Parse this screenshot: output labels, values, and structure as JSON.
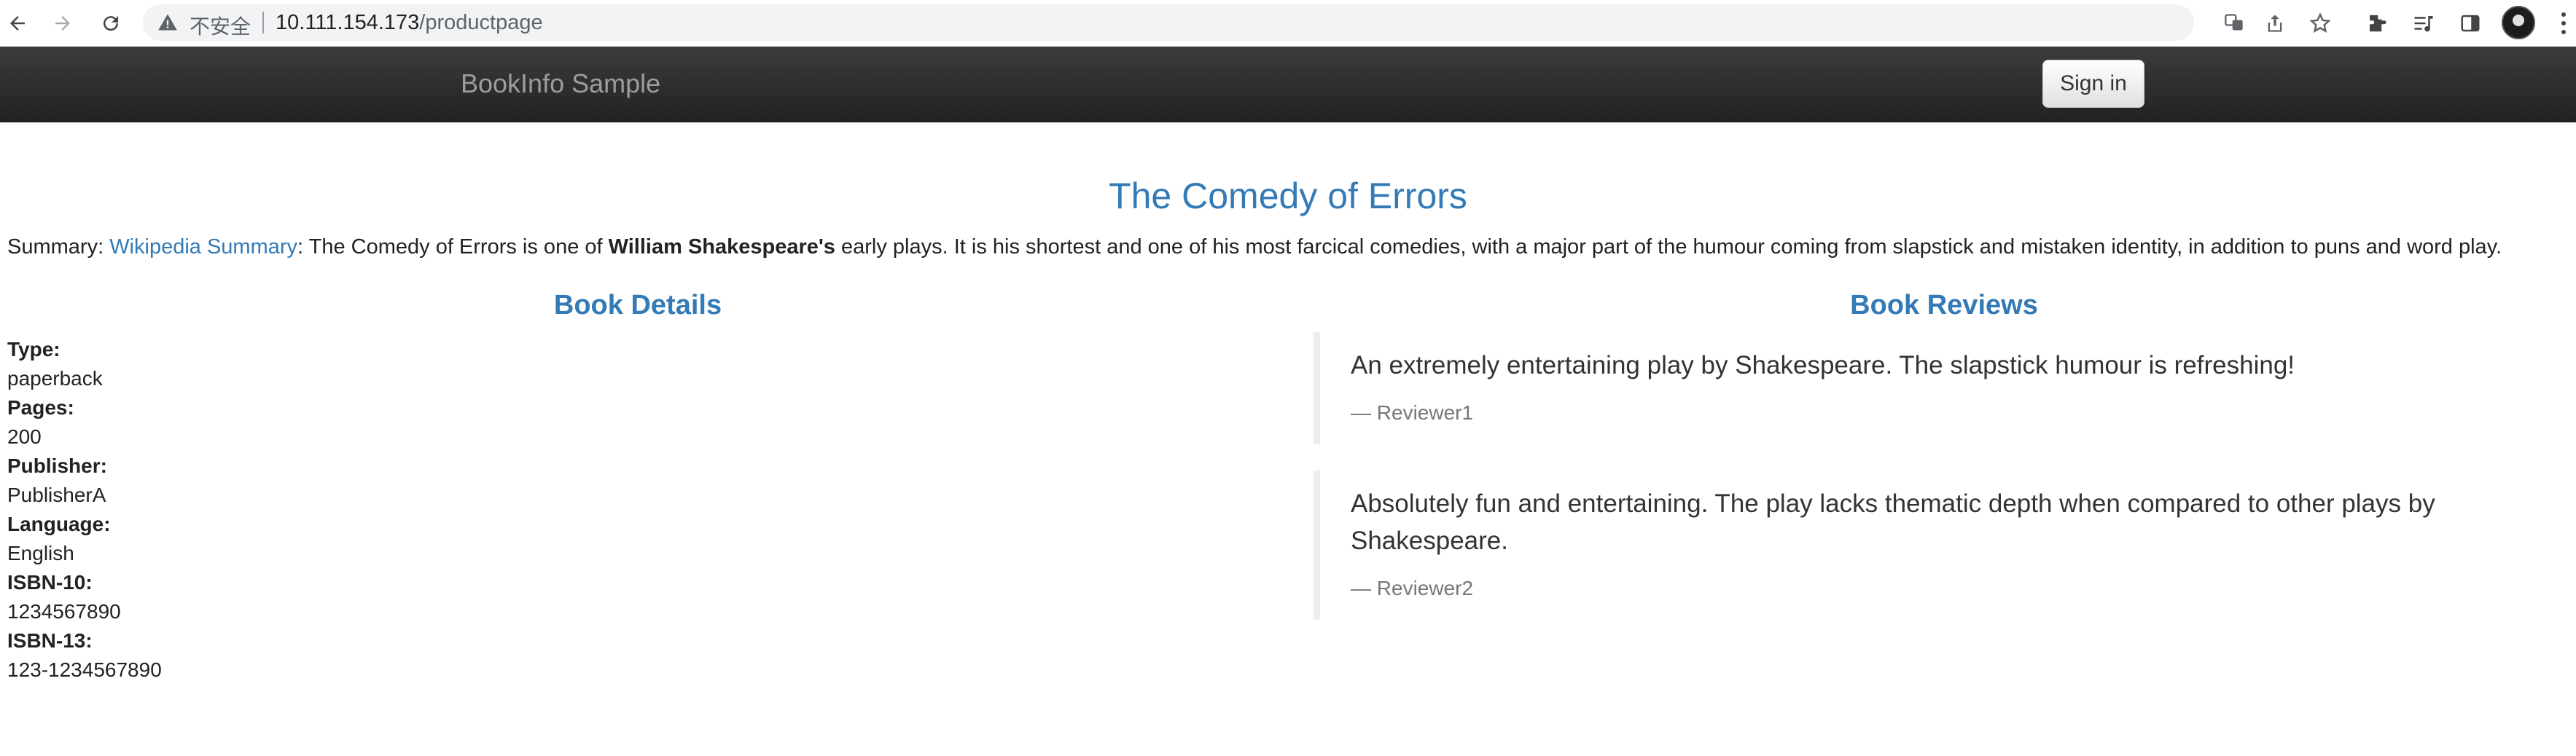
{
  "browser": {
    "security_label": "不安全",
    "url_host": "10.111.154.173",
    "url_path": "/productpage"
  },
  "navbar": {
    "brand": "BookInfo Sample",
    "sign_in_label": "Sign in"
  },
  "product": {
    "title": "The Comedy of Errors",
    "summary_prefix": "Summary: ",
    "summary_link": "Wikipedia Summary",
    "summary_text_1": ": The Comedy of Errors is one of ",
    "summary_bold": "William Shakespeare's",
    "summary_text_2": " early plays. It is his shortest and one of his most farcical comedies, with a major part of the humour coming from slapstick and mistaken identity, in addition to puns and word play."
  },
  "details": {
    "heading": "Book Details",
    "fields": [
      {
        "label": "Type:",
        "value": "paperback"
      },
      {
        "label": "Pages:",
        "value": "200"
      },
      {
        "label": "Publisher:",
        "value": "PublisherA"
      },
      {
        "label": "Language:",
        "value": "English"
      },
      {
        "label": "ISBN-10:",
        "value": "1234567890"
      },
      {
        "label": "ISBN-13:",
        "value": "123-1234567890"
      }
    ]
  },
  "reviews": {
    "heading": "Book Reviews",
    "items": [
      {
        "text": "An extremely entertaining play by Shakespeare. The slapstick humour is refreshing!",
        "reviewer": "— Reviewer1"
      },
      {
        "text": "Absolutely fun and entertaining. The play lacks thematic depth when compared to other plays by Shakespeare.",
        "reviewer": "— Reviewer2"
      }
    ]
  },
  "colors": {
    "accent": "#337ab7",
    "navbar": "#222222"
  }
}
